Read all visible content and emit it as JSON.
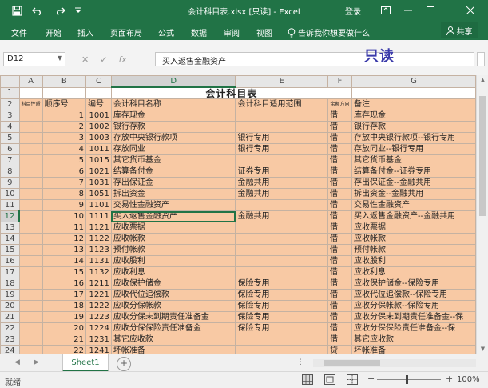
{
  "app": {
    "title": "会计科目表.xlsx [只读] - Excel",
    "login_label": "登录"
  },
  "ribbon": {
    "tabs": [
      "文件",
      "开始",
      "插入",
      "页面布局",
      "公式",
      "数据",
      "审阅",
      "视图"
    ],
    "tell_me": "告诉我你想要做什么",
    "share": "共享"
  },
  "formula_bar": {
    "cell_ref": "D12",
    "content": "买入返售金融资产",
    "fx_label": "fx"
  },
  "overlay": {
    "readonly_note": "只读"
  },
  "sheet": {
    "columns": [
      "A",
      "B",
      "C",
      "D",
      "E",
      "F",
      "G"
    ],
    "selected_column": "D",
    "title": "会计科目表",
    "header_row": [
      "科目性质",
      "顺序号",
      "编号",
      "会计科目名称",
      "会计科目适用范围",
      "余额方向",
      "备注"
    ],
    "rows": [
      {
        "row": "3",
        "seq": "1",
        "code": "1001",
        "name": "库存现金",
        "scope": "",
        "dir": "借",
        "note": "库存现金"
      },
      {
        "row": "4",
        "seq": "2",
        "code": "1002",
        "name": "银行存款",
        "scope": "",
        "dir": "借",
        "note": "银行存款"
      },
      {
        "row": "5",
        "seq": "3",
        "code": "1003",
        "name": "存放中央银行款项",
        "scope": "银行专用",
        "dir": "借",
        "note": "存放中央银行款项--银行专用"
      },
      {
        "row": "6",
        "seq": "4",
        "code": "1011",
        "name": "存放同业",
        "scope": "银行专用",
        "dir": "借",
        "note": "存放同业--银行专用"
      },
      {
        "row": "7",
        "seq": "5",
        "code": "1015",
        "name": "其它货币基金",
        "scope": "",
        "dir": "借",
        "note": "其它货币基金"
      },
      {
        "row": "8",
        "seq": "6",
        "code": "1021",
        "name": "结算备付金",
        "scope": "证券专用",
        "dir": "借",
        "note": "结算备付金--证券专用"
      },
      {
        "row": "9",
        "seq": "7",
        "code": "1031",
        "name": "存出保证金",
        "scope": "金融共用",
        "dir": "借",
        "note": "存出保证金--金融共用"
      },
      {
        "row": "10",
        "seq": "8",
        "code": "1051",
        "name": "拆出资金",
        "scope": "金融共用",
        "dir": "借",
        "note": "拆出资金--金融共用"
      },
      {
        "row": "11",
        "seq": "9",
        "code": "1101",
        "name": "交易性金融资产",
        "scope": "",
        "dir": "借",
        "note": "交易性金融资产"
      },
      {
        "row": "12",
        "seq": "10",
        "code": "1111",
        "name": "买入返售金融资产",
        "scope": "金融共用",
        "dir": "借",
        "note": "买入返售金融资产--金融共用"
      },
      {
        "row": "13",
        "seq": "11",
        "code": "1121",
        "name": "应收票据",
        "scope": "",
        "dir": "借",
        "note": "应收票据"
      },
      {
        "row": "14",
        "seq": "12",
        "code": "1122",
        "name": "应收帐款",
        "scope": "",
        "dir": "借",
        "note": "应收帐款"
      },
      {
        "row": "15",
        "seq": "13",
        "code": "1123",
        "name": "预付帐款",
        "scope": "",
        "dir": "借",
        "note": "预付帐款"
      },
      {
        "row": "16",
        "seq": "14",
        "code": "1131",
        "name": "应收股利",
        "scope": "",
        "dir": "借",
        "note": "应收股利"
      },
      {
        "row": "17",
        "seq": "15",
        "code": "1132",
        "name": "应收利息",
        "scope": "",
        "dir": "借",
        "note": "应收利息"
      },
      {
        "row": "18",
        "seq": "16",
        "code": "1211",
        "name": "应收保护储金",
        "scope": "保险专用",
        "dir": "借",
        "note": "应收保护储金--保险专用"
      },
      {
        "row": "19",
        "seq": "17",
        "code": "1221",
        "name": "应收代位追偿款",
        "scope": "保险专用",
        "dir": "借",
        "note": "应收代位追偿款--保险专用"
      },
      {
        "row": "20",
        "seq": "18",
        "code": "1222",
        "name": "应收分保帐款",
        "scope": "保险专用",
        "dir": "借",
        "note": "应收分保帐款--保险专用"
      },
      {
        "row": "21",
        "seq": "19",
        "code": "1223",
        "name": "应收分保未到期责任准备金",
        "scope": "保险专用",
        "dir": "借",
        "note": "应收分保未到期责任准备金--保"
      },
      {
        "row": "22",
        "seq": "20",
        "code": "1224",
        "name": "应收分保保险责任准备金",
        "scope": "保险专用",
        "dir": "借",
        "note": "应收分保保险责任准备金--保"
      },
      {
        "row": "23",
        "seq": "21",
        "code": "1231",
        "name": "其它应收款",
        "scope": "",
        "dir": "借",
        "note": "其它应收款"
      },
      {
        "row": "24",
        "seq": "22",
        "code": "1241",
        "name": "坏帐准备",
        "scope": "",
        "dir": "贷",
        "note": "坏帐准备"
      }
    ]
  },
  "sheet_tabs": {
    "active": "Sheet1"
  },
  "status_bar": {
    "ready": "就绪",
    "zoom": "100%"
  },
  "colors": {
    "excel_green": "#217346",
    "cell_fill": "#f8c9a4",
    "readonly_text": "#3b3baa"
  }
}
